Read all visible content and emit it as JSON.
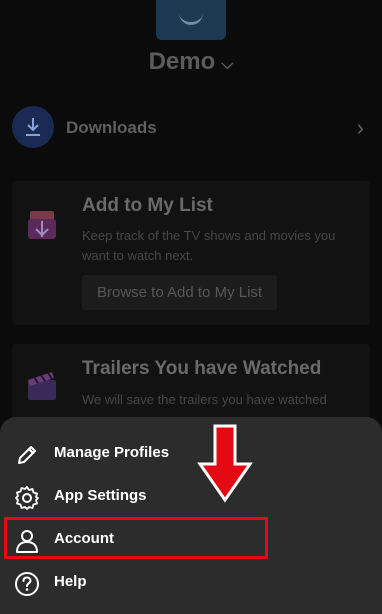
{
  "profile": {
    "name": "Demo"
  },
  "downloads": {
    "label": "Downloads"
  },
  "cards": [
    {
      "title": "Add to My List",
      "text": "Keep track of the TV shows and movies you want to watch next.",
      "button": "Browse to Add to My List"
    },
    {
      "title": "Trailers You have Watched",
      "text": "We will save the trailers you have watched"
    }
  ],
  "menu": {
    "items": [
      {
        "label": "Manage Profiles",
        "icon": "pencil-icon"
      },
      {
        "label": "App Settings",
        "icon": "gear-icon"
      },
      {
        "label": "Account",
        "icon": "person-icon"
      },
      {
        "label": "Help",
        "icon": "help-icon"
      }
    ]
  },
  "colors": {
    "highlight": "#e50914",
    "downloads_accent": "#1a2a55",
    "sheet": "#2c2c2c"
  }
}
